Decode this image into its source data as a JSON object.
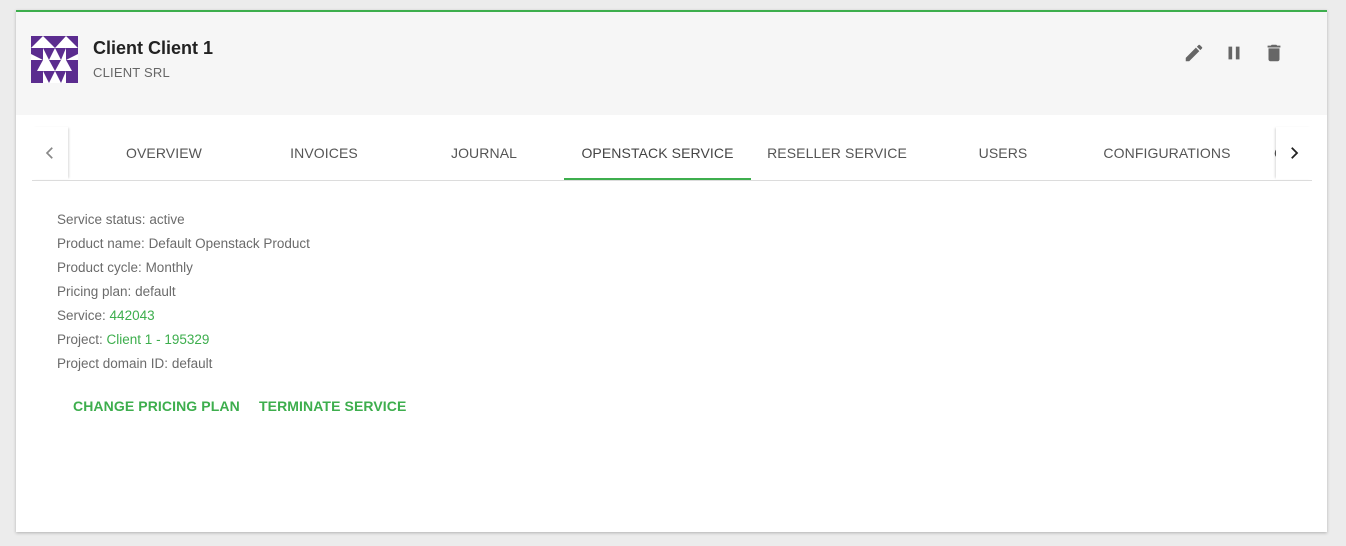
{
  "header": {
    "client_name": "Client Client 1",
    "company": "CLIENT SRL",
    "accent_color": "#3dae4d",
    "avatar_color": "#5b2c8f",
    "actions": [
      {
        "name": "edit-icon",
        "label": "Edit"
      },
      {
        "name": "pause-icon",
        "label": "Suspend"
      },
      {
        "name": "delete-icon",
        "label": "Delete"
      }
    ]
  },
  "tabs": {
    "items": [
      {
        "label": "OVERVIEW",
        "active": false
      },
      {
        "label": "INVOICES",
        "active": false
      },
      {
        "label": "JOURNAL",
        "active": false
      },
      {
        "label": "OPENSTACK SERVICE",
        "active": true
      },
      {
        "label": "RESELLER SERVICE",
        "active": false
      },
      {
        "label": "USERS",
        "active": false
      },
      {
        "label": "CONFIGURATIONS",
        "active": false
      },
      {
        "label": "CL",
        "active": false
      }
    ]
  },
  "details": {
    "status_label": "Service status:",
    "status_value": "active",
    "product_label": "Product name:",
    "product_value": "Default Openstack Product",
    "cycle_label": "Product cycle:",
    "cycle_value": "Monthly",
    "plan_label": "Pricing plan:",
    "plan_value": "default",
    "service_label": "Service:",
    "service_value": "442043",
    "project_label": "Project:",
    "project_value": "Client 1 - 195329",
    "domain_label": "Project domain ID:",
    "domain_value": "default"
  },
  "actions": {
    "change_plan": "CHANGE PRICING PLAN",
    "terminate": "TERMINATE SERVICE"
  }
}
